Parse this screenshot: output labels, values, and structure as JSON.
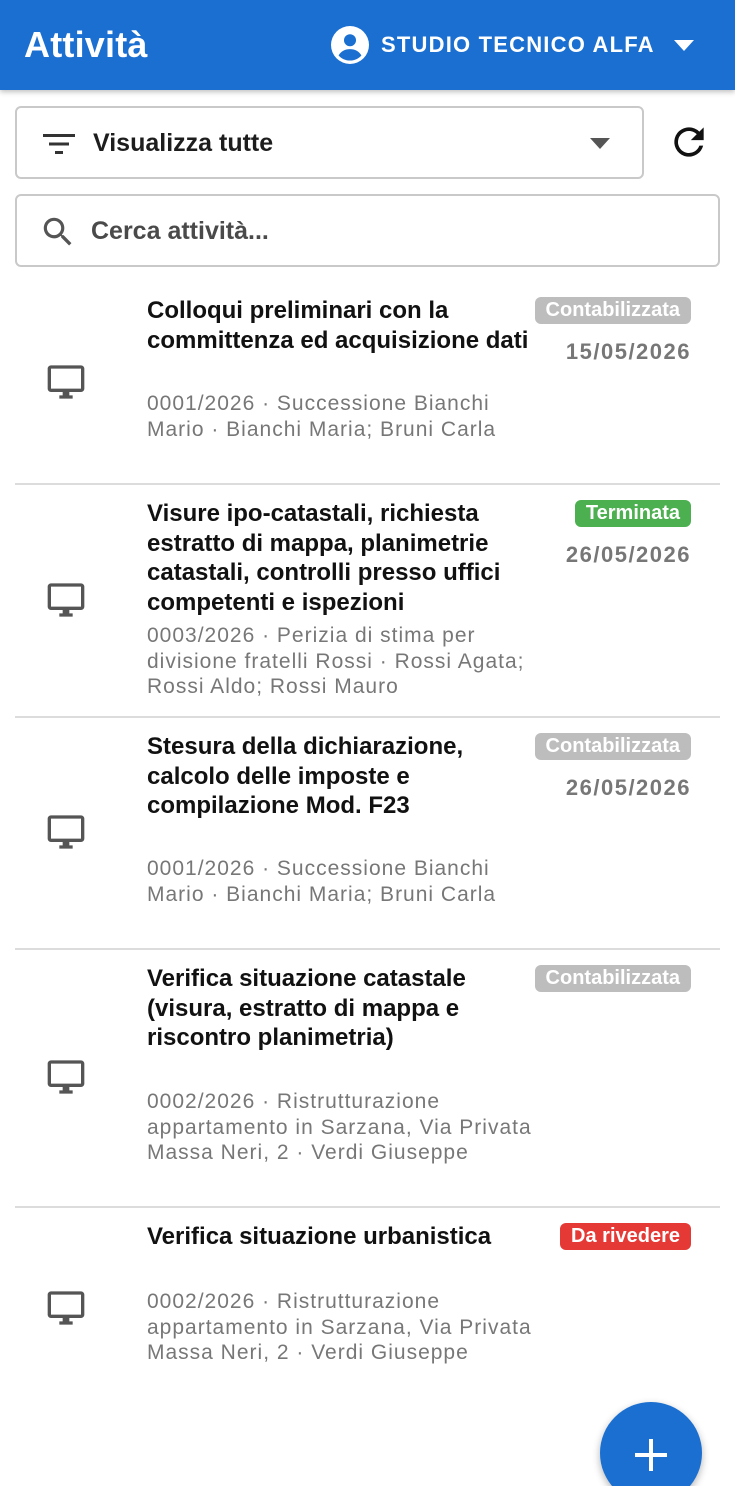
{
  "appbar": {
    "title": "Attività",
    "account_name": "STUDIO TECNICO ALFA",
    "color": "#1a6fd0"
  },
  "filter": {
    "selected": "Visualizza tutte",
    "icon": "filter-list-icon"
  },
  "search": {
    "placeholder": "Cerca attività...",
    "value": ""
  },
  "activities": [
    {
      "title": "Colloqui preliminari con la committenza ed acquisizione dati",
      "subtitle": "0001/2026 · Successione Bianchi Mario · Bianchi Maria; Bruni Carla",
      "status": "Contabilizzata",
      "status_color": "#bdbdbd",
      "date": "15/05/2026",
      "icon": "desktop-icon"
    },
    {
      "title": "Visure ipo-catastali, richiesta estratto di mappa, planimetrie catastali, controlli presso uffici competenti e ispezioni",
      "subtitle": "0003/2026 · Perizia di stima per divisione fratelli Rossi · Rossi Agata; Rossi Aldo; Rossi Mauro",
      "status": "Terminata",
      "status_color": "#4caf50",
      "date": "26/05/2026",
      "icon": "desktop-icon"
    },
    {
      "title": "Stesura della dichiarazione, calcolo delle imposte e compilazione Mod. F23",
      "subtitle": "0001/2026 · Successione Bianchi Mario · Bianchi Maria; Bruni Carla",
      "status": "Contabilizzata",
      "status_color": "#bdbdbd",
      "date": "26/05/2026",
      "icon": "desktop-icon"
    },
    {
      "title": "Verifica situazione catastale (visura, estratto di mappa e riscontro planimetria)",
      "subtitle": "0002/2026 · Ristrutturazione appartamento in Sarzana, Via Privata Massa Neri, 2 · Verdi Giuseppe",
      "status": "Contabilizzata",
      "status_color": "#bdbdbd",
      "date": "",
      "icon": "desktop-icon"
    },
    {
      "title": "Verifica situazione urbanistica",
      "subtitle": "0002/2026 · Ristrutturazione appartamento in Sarzana, Via Privata Massa Neri, 2 · Verdi Giuseppe",
      "status": "Da rivedere",
      "status_color": "#e53935",
      "date": "",
      "icon": "desktop-icon"
    }
  ],
  "fab": {
    "icon": "plus-icon"
  }
}
